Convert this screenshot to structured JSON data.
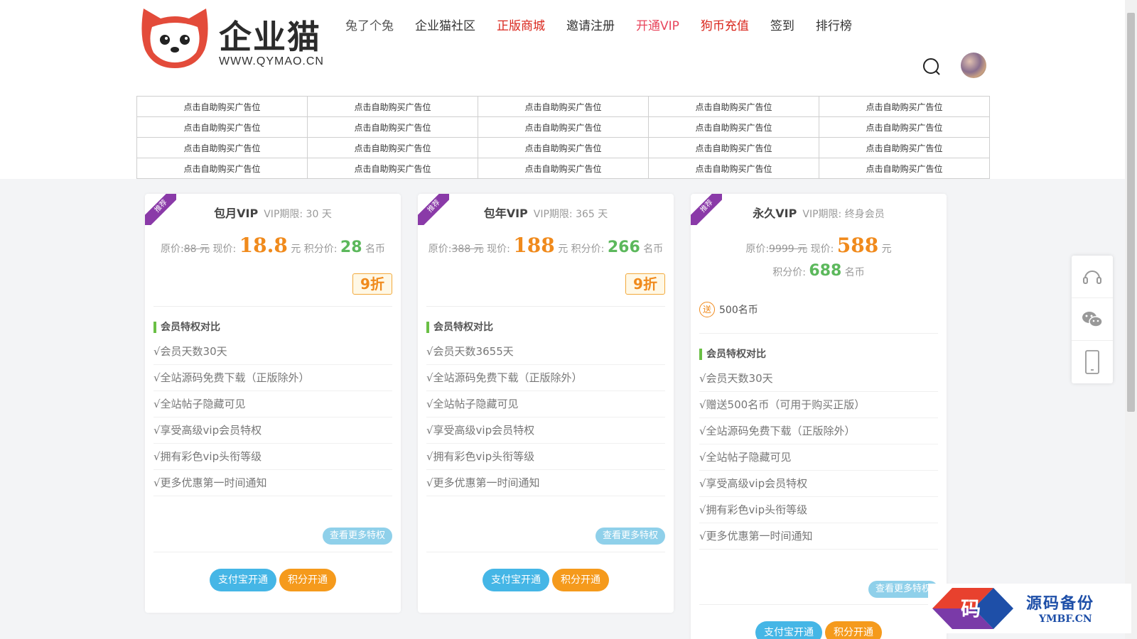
{
  "header": {
    "logo_text": "企业猫",
    "logo_url": "WWW.QYMAO.CN",
    "nav": [
      {
        "label": "兔了个兔"
      },
      {
        "label": "企业猫社区"
      },
      {
        "label": "正版商城"
      },
      {
        "label": "邀请注册"
      },
      {
        "label": "开通VIP"
      },
      {
        "label": "狗币充值"
      },
      {
        "label": "签到"
      },
      {
        "label": "排行榜"
      }
    ]
  },
  "ads": {
    "cell_label": "点击自助购买广告位",
    "rows": 4,
    "cols": 5
  },
  "plans": [
    {
      "ribbon": "推荐",
      "name": "包月VIP",
      "period": "VIP期限: 30 天",
      "orig_label": "原价:",
      "orig_price": "88 元",
      "now_label": "现价:",
      "price": "18.8",
      "unit": "元",
      "points_label": "积分价:",
      "points": "28",
      "points_unit": "名币",
      "discount": "9折",
      "section_title": "会员特权对比",
      "features": [
        "√会员天数30天",
        "√全站源码免费下载（正版除外）",
        "√全站帖子隐藏可见",
        "√享受高级vip会员特权",
        "√拥有彩色vip头衔等级",
        "√更多优惠第一时间通知"
      ],
      "more": "查看更多特权",
      "alipay": "支付宝开通",
      "points_btn": "积分开通"
    },
    {
      "ribbon": "推荐",
      "name": "包年VIP",
      "period": "VIP期限: 365 天",
      "orig_label": "原价:",
      "orig_price": "388 元",
      "now_label": "现价:",
      "price": "188",
      "unit": "元",
      "points_label": "积分价:",
      "points": "266",
      "points_unit": "名币",
      "discount": "9折",
      "section_title": "会员特权对比",
      "features": [
        "√会员天数3655天",
        "√全站源码免费下载（正版除外）",
        "√全站帖子隐藏可见",
        "√享受高级vip会员特权",
        "√拥有彩色vip头衔等级",
        "√更多优惠第一时间通知"
      ],
      "more": "查看更多特权",
      "alipay": "支付宝开通",
      "points_btn": "积分开通"
    },
    {
      "ribbon": "推荐",
      "name": "永久VIP",
      "period": "VIP期限: 终身会员",
      "orig_label": "原价:",
      "orig_price": "9999 元",
      "now_label": "现价:",
      "price": "588",
      "unit": "元",
      "points_label": "积分价:",
      "points": "688",
      "points_unit": "名币",
      "gift_badge": "送",
      "gift": "500名币",
      "section_title": "会员特权对比",
      "features": [
        "√会员天数30天",
        "√赠送500名币（可用于购买正版）",
        "√全站源码免费下载（正版除外）",
        "√全站帖子隐藏可见",
        "√享受高级vip会员特权",
        "√拥有彩色vip头衔等级",
        "√更多优惠第一时间通知"
      ],
      "more": "查看更多特权",
      "alipay": "支付宝开通",
      "points_btn": "积分开通"
    }
  ],
  "watermark": {
    "glyph": "码",
    "text": "源码备份",
    "url": "YMBF.CN"
  },
  "colors": {
    "accent_red": "#d9261c",
    "price_orange": "#f08a1c",
    "points_green": "#5cb85c",
    "alipay_blue": "#45b6e6",
    "ribbon_purple": "#8a3aa8"
  },
  "icons": {
    "search": "search-icon",
    "support": "headset-icon",
    "wechat": "wechat-icon",
    "mobile": "mobile-icon"
  }
}
